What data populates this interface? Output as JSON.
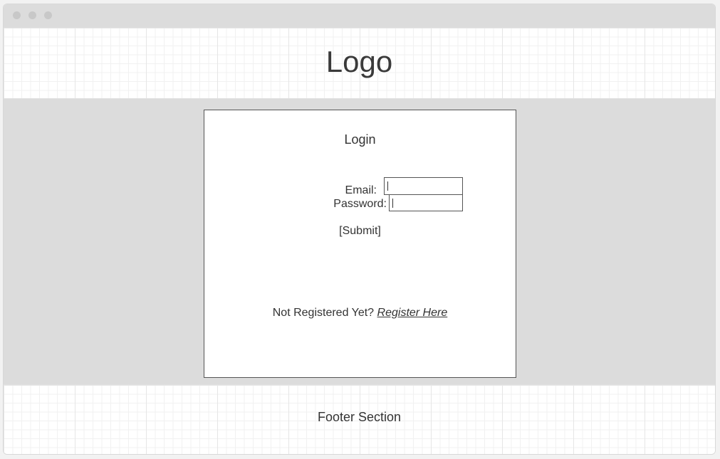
{
  "header": {
    "logo": "Logo"
  },
  "login": {
    "title": "Login",
    "email_label": "Email:",
    "email_value": "",
    "password_label": "Password:",
    "password_value": "",
    "submit_label": "[Submit]",
    "register_prompt": "Not Registered Yet?",
    "register_link": "Register Here"
  },
  "footer": {
    "text": "Footer Section"
  },
  "colors": {
    "frame_gray": "#dcdcdc",
    "text": "#333333",
    "grid_line": "#e6e6e6"
  }
}
